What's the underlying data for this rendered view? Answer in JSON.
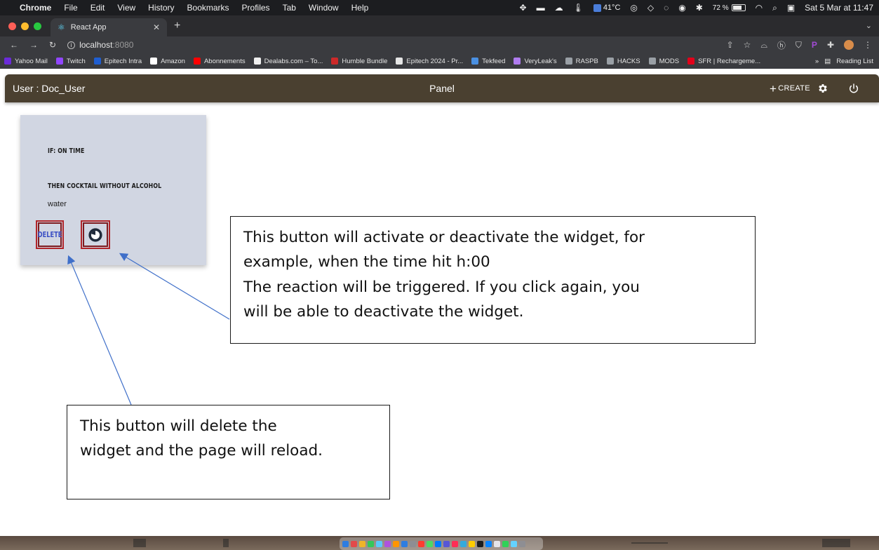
{
  "menubar": {
    "app_name": "Chrome",
    "items": [
      "File",
      "Edit",
      "View",
      "History",
      "Bookmarks",
      "Profiles",
      "Tab",
      "Window",
      "Help"
    ],
    "temperature": "41°C",
    "battery": "72 %",
    "datetime": "Sat 5 Mar at 11:47"
  },
  "browser": {
    "tab_title": "React App",
    "url_host": "localhost",
    "url_port": ":8080",
    "bookmarks": [
      {
        "label": "Yahoo Mail",
        "color": "#6b2bd9"
      },
      {
        "label": "Twitch",
        "color": "#9146ff"
      },
      {
        "label": "Epitech Intra",
        "color": "#1f5ed1"
      },
      {
        "label": "Amazon",
        "color": "#ffffff"
      },
      {
        "label": "Abonnements",
        "color": "#ff0000"
      },
      {
        "label": "Dealabs.com – To...",
        "color": "#f0f0f0"
      },
      {
        "label": "Humble Bundle",
        "color": "#cc2929"
      },
      {
        "label": "Epitech 2024 - Pr...",
        "color": "#e6e6e6"
      },
      {
        "label": "Tekfeed",
        "color": "#4a90e2"
      },
      {
        "label": "VeryLeak's",
        "color": "#b07cf0"
      },
      {
        "label": "RASPB",
        "color": "#9aa0a6"
      },
      {
        "label": "HACKS",
        "color": "#9aa0a6"
      },
      {
        "label": "MODS",
        "color": "#9aa0a6"
      },
      {
        "label": "SFR | Rechargeme...",
        "color": "#e2001a"
      }
    ],
    "reading_list": "Reading List"
  },
  "app": {
    "user_label": "User : Doc_User",
    "panel_title": "Panel",
    "create_label": "CREATE",
    "colors": {
      "appbar": "#4a4030",
      "card": "#d1d6e2",
      "highlight": "#b0252a",
      "delete_text": "#3b4fc4"
    }
  },
  "widget": {
    "condition": "IF: ON TIME",
    "reaction_title": "THEN COCKTAIL WITHOUT ALCOHOL",
    "reaction_value": "water",
    "delete_label": "DELETE",
    "toggle_icon": "toggle-icon"
  },
  "annotations": {
    "toggle_line1": "This button will activate or deactivate the widget, for",
    "toggle_line2": "example, when the time hit h:00",
    "toggle_line3": "The reaction will be triggered. If you click again, you",
    "toggle_line4": "will be able to deactivate the widget.",
    "delete_line1": "This button will delete the",
    "delete_line2": "widget and the page will reload."
  }
}
